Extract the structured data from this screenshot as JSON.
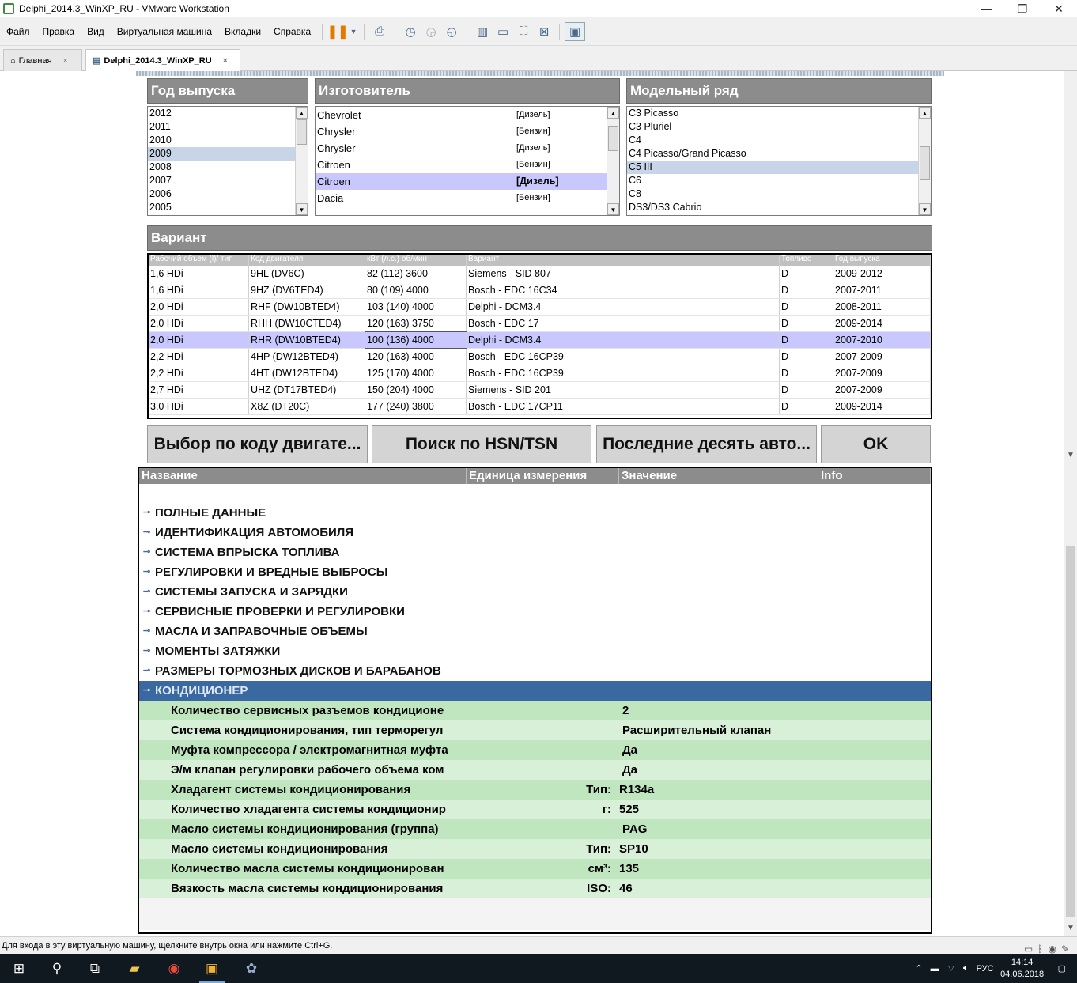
{
  "window": {
    "title": "Delphi_2014.3_WinXP_RU - VMware Workstation"
  },
  "menubar": {
    "items": [
      "Файл",
      "Правка",
      "Вид",
      "Виртуальная машина",
      "Вкладки",
      "Справка"
    ]
  },
  "tabs": [
    {
      "label": "Главная",
      "close": "×"
    },
    {
      "label": "Delphi_2014.3_WinXP_RU",
      "close": "×"
    }
  ],
  "year_panel": {
    "title": "Год выпуска",
    "items": [
      "2012",
      "2011",
      "2010",
      "2009",
      "2008",
      "2007",
      "2006",
      "2005"
    ],
    "selected": "2009"
  },
  "manufacturer_panel": {
    "title": "Изготовитель",
    "items": [
      {
        "name": "Chevrolet",
        "fuel": "[Дизель]"
      },
      {
        "name": "Chrysler",
        "fuel": "[Бензин]"
      },
      {
        "name": "Chrysler",
        "fuel": "[Дизель]"
      },
      {
        "name": "Citroen",
        "fuel": "[Бензин]"
      },
      {
        "name": "Citroen",
        "fuel": "[Дизель]"
      },
      {
        "name": "Dacia",
        "fuel": "[Бензин]"
      }
    ],
    "selected_index": 4
  },
  "model_panel": {
    "title": "Модельный ряд",
    "items": [
      "C3 Picasso",
      "C3 Pluriel",
      "C4",
      "C4 Picasso/Grand Picasso",
      "C5 III",
      "C6",
      "C8",
      "DS3/DS3 Cabrio"
    ],
    "selected": "C5 III"
  },
  "variant_panel": {
    "title": "Вариант",
    "columns": [
      "Рабочий объем (l)/ тип",
      "Код двигателя",
      "кВт (л.с.) об/мин",
      "Вариант",
      "Топливо",
      "Год выпуска"
    ],
    "rows": [
      [
        "1,6 HDi",
        "9HL (DV6C)",
        "82 (112) 3600",
        "Siemens - SID 807",
        "D",
        "2009-2012"
      ],
      [
        "1,6 HDi",
        "9HZ (DV6TED4)",
        "80 (109) 4000",
        "Bosch - EDC 16C34",
        "D",
        "2007-2011"
      ],
      [
        "2,0 HDi",
        "RHF (DW10BTED4)",
        "103 (140) 4000",
        "Delphi - DCM3.4",
        "D",
        "2008-2011"
      ],
      [
        "2,0 HDi",
        "RHH (DW10CTED4)",
        "120 (163) 3750",
        "Bosch - EDC 17",
        "D",
        "2009-2014"
      ],
      [
        "2,0 HDi",
        "RHR (DW10BTED4)",
        "100 (136) 4000",
        "Delphi - DCM3.4",
        "D",
        "2007-2010"
      ],
      [
        "2,2 HDi",
        "4HP (DW12BTED4)",
        "120 (163) 4000",
        "Bosch - EDC 16CP39",
        "D",
        "2007-2009"
      ],
      [
        "2,2 HDi",
        "4HT (DW12BTED4)",
        "125 (170) 4000",
        "Bosch - EDC 16CP39",
        "D",
        "2007-2009"
      ],
      [
        "2,7 HDi",
        "UHZ (DT17BTED4)",
        "150 (204) 4000",
        "Siemens - SID 201",
        "D",
        "2007-2009"
      ],
      [
        "3,0 HDi",
        "X8Z (DT20C)",
        "177 (240) 3800",
        "Bosch - EDC 17CP11",
        "D",
        "2009-2014"
      ]
    ],
    "selected_index": 4
  },
  "buttons": {
    "engine_code": "Выбор по коду двигате...",
    "hsn_tsn": "Поиск по HSN/TSN",
    "last_ten": "Последние десять авто...",
    "ok": "OK"
  },
  "data_panel": {
    "columns": [
      "Название",
      "Единица измерения",
      "Значение",
      "Info"
    ],
    "categories": [
      "ПОЛНЫЕ ДАННЫЕ",
      "ИДЕНТИФИКАЦИЯ АВТОМОБИЛЯ",
      "СИСТЕМА ВПРЫСКА ТОПЛИВА",
      "РЕГУЛИРОВКИ И ВРЕДНЫЕ ВЫБРОСЫ",
      "СИСТЕМЫ ЗАПУСКА И ЗАРЯДКИ",
      "СЕРВИСНЫЕ ПРОВЕРКИ И РЕГУЛИРОВКИ",
      "МАСЛА И ЗАПРАВОЧНЫЕ ОБЪЕМЫ",
      "МОМЕНТЫ ЗАТЯЖКИ",
      "РАЗМЕРЫ ТОРМОЗНЫХ ДИСКОВ И БАРАБАНОВ"
    ],
    "expanded_category": "КОНДИЦИОНЕР",
    "rows": [
      {
        "name": "Количество сервисных разъемов кондиционе",
        "unit": "",
        "value": "2"
      },
      {
        "name": "Система кондиционирования, тип терморегул",
        "unit": "",
        "value": "Расширительный клапан"
      },
      {
        "name": "Муфта компрессора / электромагнитная муфта",
        "unit": "",
        "value": "Да"
      },
      {
        "name": "Э/м клапан регулировки рабочего объема ком",
        "unit": "",
        "value": "Да"
      },
      {
        "name": "Хладагент системы кондиционирования",
        "unit": "Тип:",
        "value": "R134a"
      },
      {
        "name": "Количество хладагента системы кондиционир",
        "unit": "г:",
        "value": "525"
      },
      {
        "name": "Масло системы кондиционирования (группа)",
        "unit": "",
        "value": "PAG"
      },
      {
        "name": "Масло системы кондиционирования",
        "unit": "Тип:",
        "value": "SP10"
      },
      {
        "name": "Количество масла системы кондиционирован",
        "unit": "см³:",
        "value": "135"
      },
      {
        "name": "Вязкость масла системы кондиционирования",
        "unit": "ISO:",
        "value": "46"
      }
    ]
  },
  "statusbar": {
    "text": "Для входа в эту виртуальную машину, щелкните внутрь окна или нажмите Ctrl+G."
  },
  "taskbar": {
    "lang": "РУС",
    "time": "14:14",
    "date": "04.06.2018"
  },
  "colors": {
    "panel_header": "#8c8c8c",
    "selection": "#c8c8ff",
    "tree_selected": "#3a68a0",
    "data_row_light": "#d8f0d8",
    "data_row_dark": "#bfe6bf"
  }
}
